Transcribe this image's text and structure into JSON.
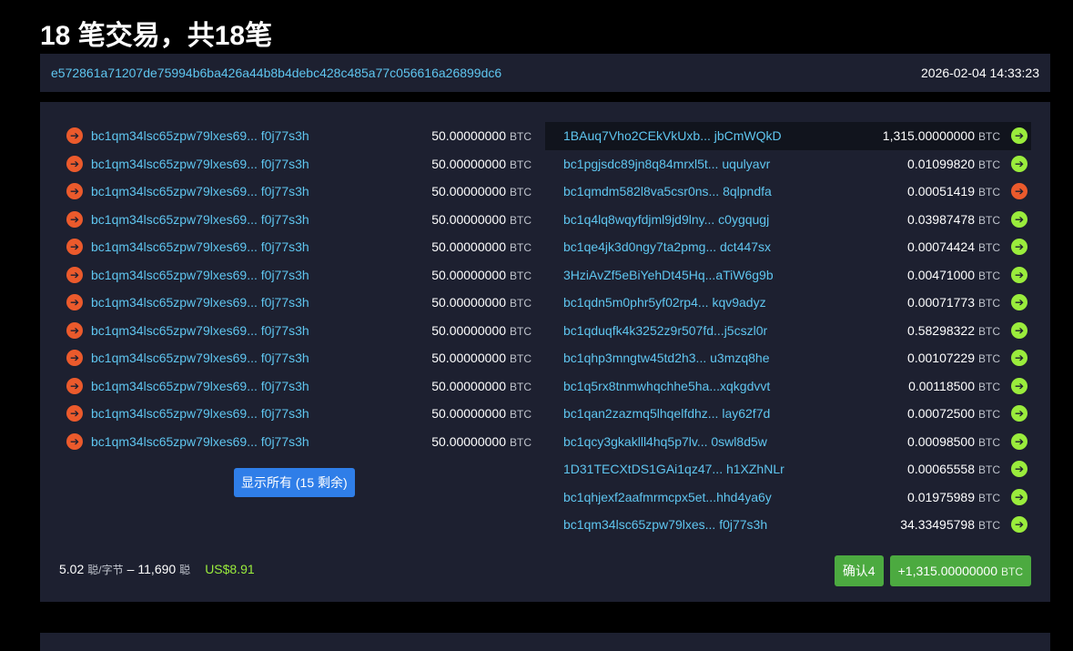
{
  "title": "18 笔交易，共18笔",
  "tx": {
    "id": "e572861a71207de75994b6ba426a44b8b4debc428c485a77c056616a26899dc6",
    "time": "2026-02-04 14:33:23"
  },
  "unit": "BTC",
  "inputs": [
    {
      "address": "bc1qm34lsc65zpw79lxes69... f0j77s3h",
      "amount": "50.00000000"
    },
    {
      "address": "bc1qm34lsc65zpw79lxes69... f0j77s3h",
      "amount": "50.00000000"
    },
    {
      "address": "bc1qm34lsc65zpw79lxes69... f0j77s3h",
      "amount": "50.00000000"
    },
    {
      "address": "bc1qm34lsc65zpw79lxes69... f0j77s3h",
      "amount": "50.00000000"
    },
    {
      "address": "bc1qm34lsc65zpw79lxes69... f0j77s3h",
      "amount": "50.00000000"
    },
    {
      "address": "bc1qm34lsc65zpw79lxes69... f0j77s3h",
      "amount": "50.00000000"
    },
    {
      "address": "bc1qm34lsc65zpw79lxes69... f0j77s3h",
      "amount": "50.00000000"
    },
    {
      "address": "bc1qm34lsc65zpw79lxes69... f0j77s3h",
      "amount": "50.00000000"
    },
    {
      "address": "bc1qm34lsc65zpw79lxes69... f0j77s3h",
      "amount": "50.00000000"
    },
    {
      "address": "bc1qm34lsc65zpw79lxes69... f0j77s3h",
      "amount": "50.00000000"
    },
    {
      "address": "bc1qm34lsc65zpw79lxes69... f0j77s3h",
      "amount": "50.00000000"
    },
    {
      "address": "bc1qm34lsc65zpw79lxes69... f0j77s3h",
      "amount": "50.00000000"
    }
  ],
  "show_all_label": "显示所有 (15 剩余)",
  "outputs": [
    {
      "address": "1BAuq7Vho2CEkVkUxb... jbCmWQkD",
      "amount": "1,315.00000000",
      "spent": false,
      "highlight": true
    },
    {
      "address": "bc1pgjsdc89jn8q84mrxl5t... uqulyavr",
      "amount": "0.01099820",
      "spent": false
    },
    {
      "address": "bc1qmdm582l8va5csr0ns... 8qlpndfa",
      "amount": "0.00051419",
      "spent": true
    },
    {
      "address": "bc1q4lq8wqyfdjml9jd9lny... c0ygqugj",
      "amount": "0.03987478",
      "spent": false
    },
    {
      "address": "bc1qe4jk3d0ngy7ta2pmg... dct447sx",
      "amount": "0.00074424",
      "spent": false
    },
    {
      "address": "3HziAvZf5eBiYehDt45Hq...aTiW6g9b",
      "amount": "0.00471000",
      "spent": false
    },
    {
      "address": "bc1qdn5m0phr5yf02rp4... kqv9adyz",
      "amount": "0.00071773",
      "spent": false
    },
    {
      "address": "bc1qduqfk4k3252z9r507fd...j5cszl0r",
      "amount": "0.58298322",
      "spent": false
    },
    {
      "address": "bc1qhp3mngtw45td2h3... u3mzq8he",
      "amount": "0.00107229",
      "spent": false
    },
    {
      "address": "bc1q5rx8tnmwhqchhe5ha...xqkgdvvt",
      "amount": "0.00118500",
      "spent": false
    },
    {
      "address": "bc1qan2zazmq5lhqelfdhz... lay62f7d",
      "amount": "0.00072500",
      "spent": false
    },
    {
      "address": "bc1qcy3gkaklll4hq5p7lv... 0swl8d5w",
      "amount": "0.00098500",
      "spent": false
    },
    {
      "address": "1D31TECXtDS1GAi1qz47... h1XZhNLr",
      "amount": "0.00065558",
      "spent": false
    },
    {
      "address": "bc1qhjexf2aafmrmcpx5et...hhd4ya6y",
      "amount": "0.01975989",
      "spent": false
    },
    {
      "address": "bc1qm34lsc65zpw79lxes... f0j77s3h",
      "amount": "34.33495798",
      "spent": false
    }
  ],
  "footer": {
    "fee_rate": "5.02",
    "fee_rate_unit": "聪/字节",
    "dash": "–",
    "fee": "11,690",
    "fee_unit": "聪",
    "usd": "US$8.91",
    "confirmations": "确认4",
    "total": "+1,315.00000000"
  },
  "colors": {
    "spent": "#eb5a2c",
    "unspent": "#9aec3c",
    "link": "#5fc6f0"
  }
}
